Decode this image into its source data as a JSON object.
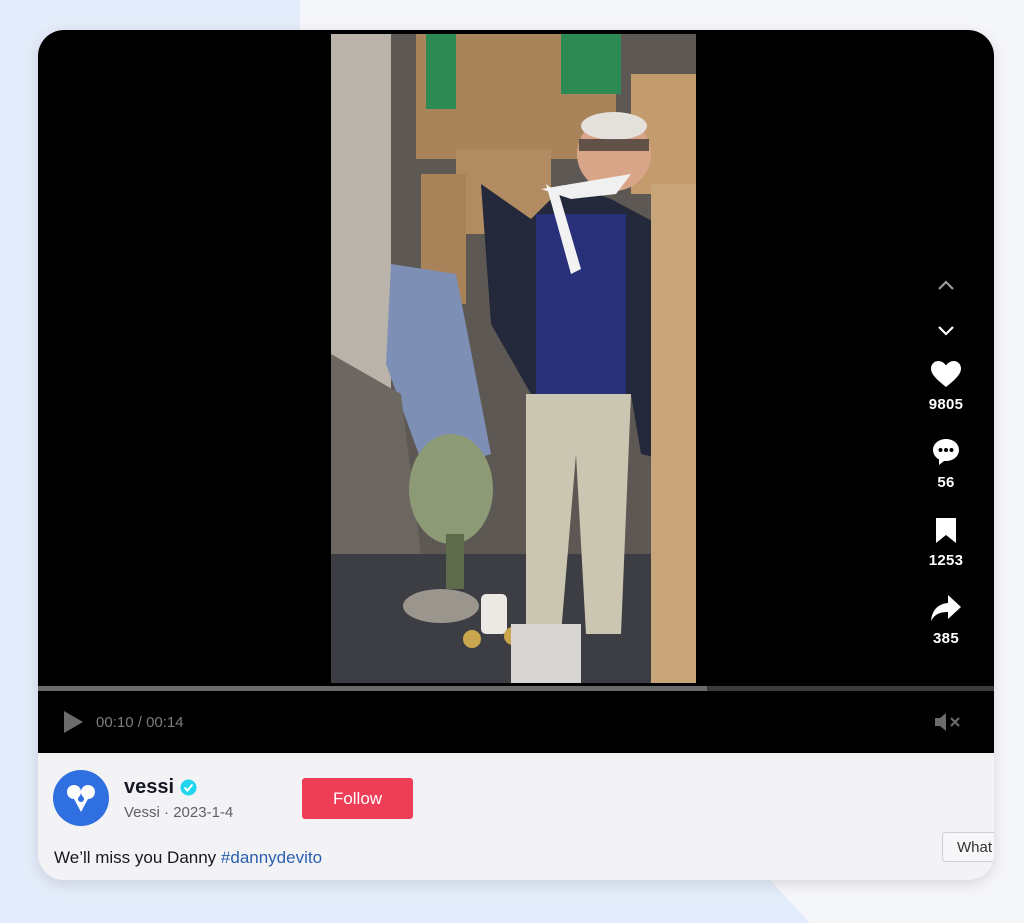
{
  "video": {
    "current_time": "00:10",
    "duration": "00:14",
    "time_separator": " / ",
    "progress_fraction": 0.7
  },
  "actions": {
    "likes": "9805",
    "comments": "56",
    "saves": "1253",
    "shares": "385"
  },
  "post": {
    "username": "vessi",
    "display_name": "Vessi",
    "date": "2023-1-4",
    "sub_separator": " · ",
    "follow_label": "Follow",
    "caption_text": "We’ll miss you Danny ",
    "hashtag": "#dannydevito",
    "partial_chip": "What"
  },
  "icons": {
    "nav_up": "chevron-up-icon",
    "nav_down": "chevron-down-icon",
    "like": "heart-icon",
    "comment": "comment-bubble-icon",
    "save": "bookmark-icon",
    "share": "share-arrow-icon",
    "play": "play-icon",
    "mute": "muted-speaker-icon",
    "verified": "verified-badge-icon",
    "avatar": "vessi-logo-icon"
  },
  "colors": {
    "follow_bg": "#ee3d56",
    "hashtag": "#2a5fb0",
    "verified": "#20d5ec",
    "avatar_bg": "#2f6fe0"
  }
}
